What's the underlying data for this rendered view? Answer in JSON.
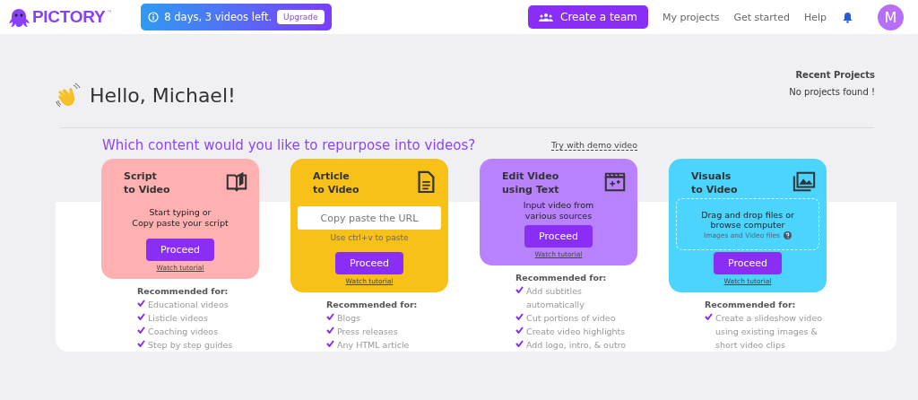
{
  "header": {
    "logo": "PICTORY",
    "logo_mark": "™",
    "trial": {
      "text": "8 days, 3 videos left.",
      "button": "Upgrade"
    },
    "team_button": "Create a team",
    "nav": [
      {
        "label": "My projects"
      },
      {
        "label": "Get started"
      },
      {
        "label": "Help"
      }
    ],
    "avatar": "M"
  },
  "greeting": "Hello, Michael!",
  "recent": {
    "title": "Recent Projects",
    "empty": "No projects found !"
  },
  "question": "Which content would you like to repurpose into videos?",
  "demo_link": "Try with demo video",
  "cards": [
    {
      "kind": "prompt",
      "color": "#ffb0b0",
      "title": [
        "Script",
        "to Video"
      ],
      "lines": [
        "Start typing or",
        "Copy paste your script"
      ],
      "button": "Proceed",
      "tutorial": "Watch tutorial",
      "recommended_title": "Recommended for:",
      "recommended": [
        "Educational videos",
        "Listicle videos",
        "Coaching videos",
        "Step by step guides"
      ]
    },
    {
      "kind": "url",
      "color": "#f8c118",
      "title": [
        "Article",
        "to Video"
      ],
      "placeholder": "Copy paste the URL",
      "hint": "Use ctrl+v to paste",
      "button": "Proceed",
      "tutorial": "Watch tutorial",
      "recommended_title": "Recommended for:",
      "recommended": [
        "Blogs",
        "Press releases",
        "Any HTML article"
      ]
    },
    {
      "kind": "prompt",
      "color": "#b882ff",
      "title": [
        "Edit Video",
        "using Text"
      ],
      "lines": [
        "Input video from",
        "various sources"
      ],
      "button": "Proceed",
      "tutorial": "Watch tutorial",
      "recommended_title": "Recommended for:",
      "recommended": [
        "Add subtitles automatically",
        "Cut portions of video",
        "Create video highlights",
        "Add logo, intro, & outro"
      ]
    },
    {
      "kind": "drop",
      "color": "#4ad4fe",
      "title": [
        "Visuals",
        "to Video"
      ],
      "lines": [
        "Drag and drop files or",
        "browse computer"
      ],
      "hint": "Images and Video files",
      "button": "Proceed",
      "tutorial": "Watch tutorial",
      "recommended_title": "Recommended for:",
      "recommended": [
        "Create a slideshow video using existing images & short video clips"
      ]
    }
  ]
}
